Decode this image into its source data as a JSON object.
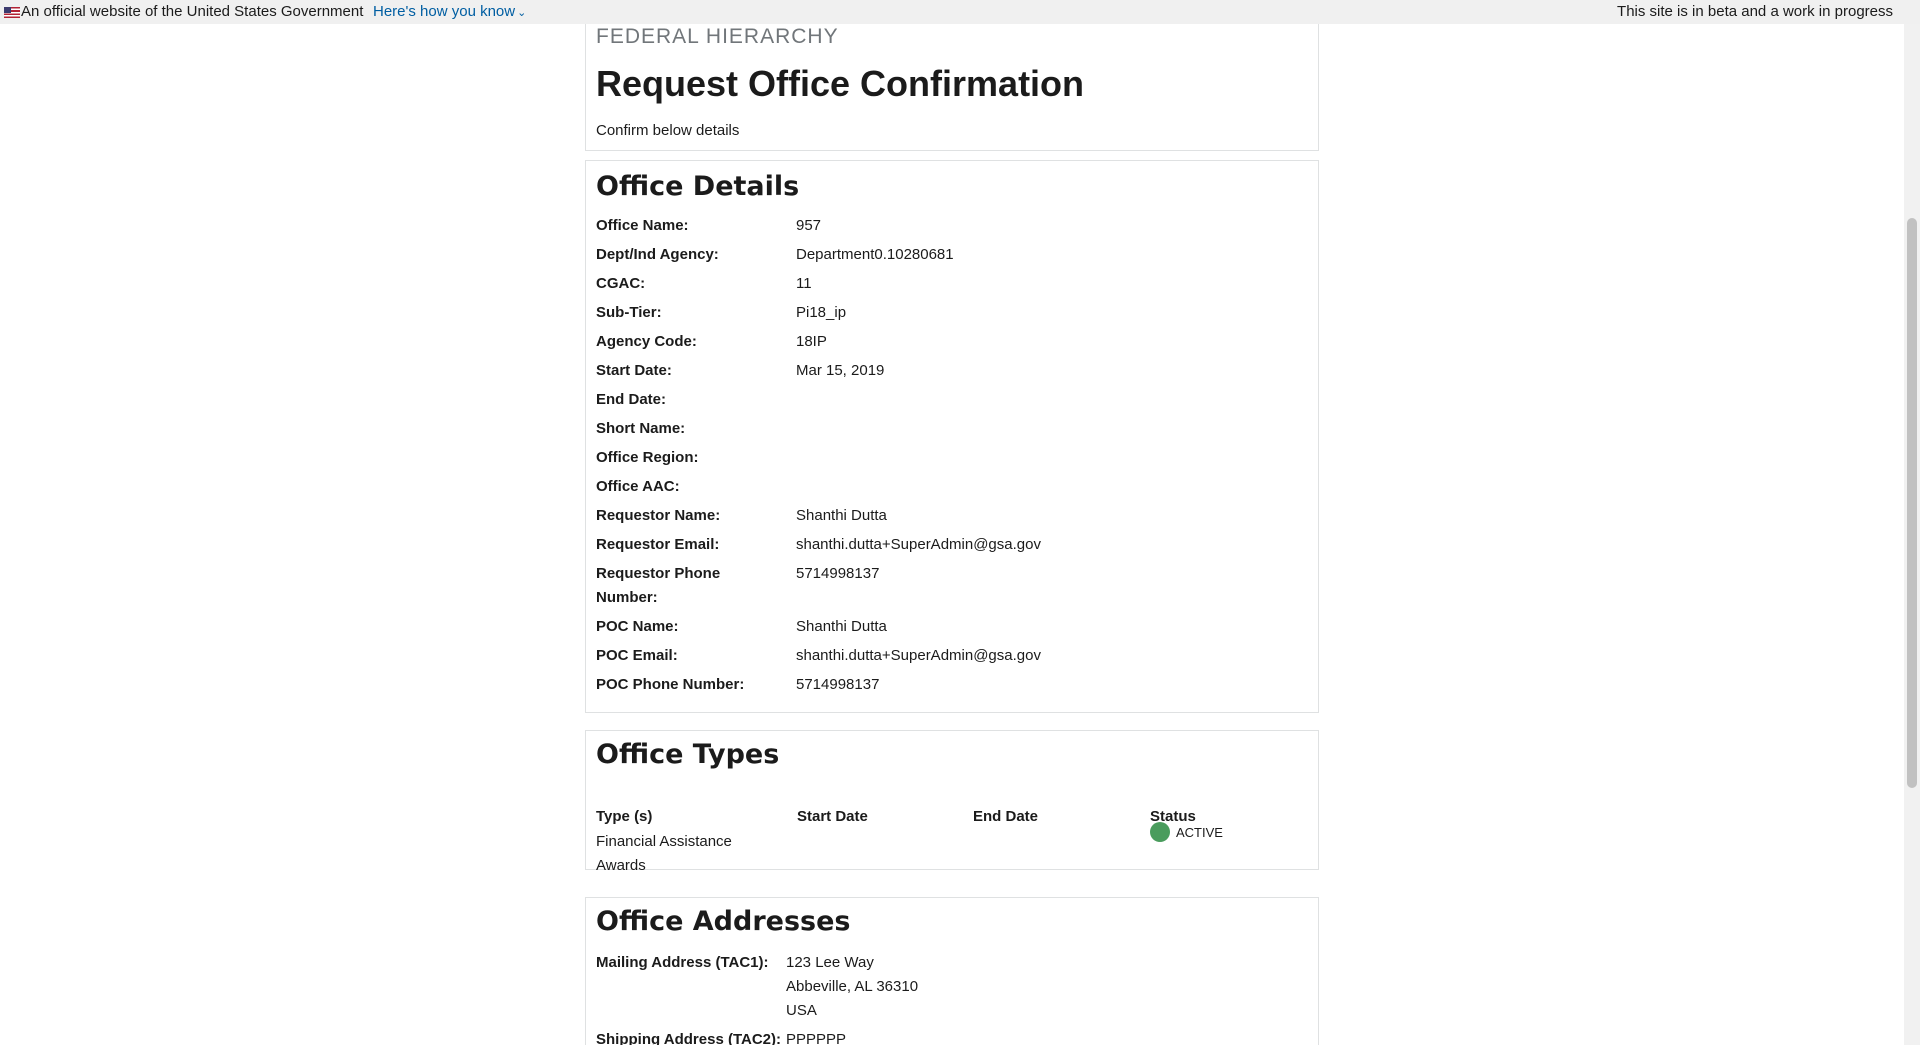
{
  "banner": {
    "official_text": "An official website of the United States Government",
    "how_link": "Here's how you know",
    "beta_text": "This site is in beta and a work in progress"
  },
  "header": {
    "eyebrow": "FEDERAL HIERARCHY",
    "title": "Request Office Confirmation",
    "subtitle": "Confirm below details"
  },
  "details": {
    "title": "Office Details",
    "fields": [
      {
        "label": "Office Name:",
        "value": "957"
      },
      {
        "label": "Dept/Ind Agency:",
        "value": "Department0.10280681"
      },
      {
        "label": "CGAC:",
        "value": "11"
      },
      {
        "label": "Sub-Tier:",
        "value": "Pi18_ip"
      },
      {
        "label": "Agency Code:",
        "value": "18IP"
      },
      {
        "label": "Start Date:",
        "value": "Mar 15, 2019"
      },
      {
        "label": "End Date:",
        "value": ""
      },
      {
        "label": "Short Name:",
        "value": ""
      },
      {
        "label": "Office Region:",
        "value": ""
      },
      {
        "label": "Office AAC:",
        "value": ""
      },
      {
        "label": "Requestor Name:",
        "value": "Shanthi Dutta"
      },
      {
        "label": "Requestor Email:",
        "value": "shanthi.dutta+SuperAdmin@gsa.gov"
      },
      {
        "label": "Requestor Phone Number:",
        "value": "5714998137"
      },
      {
        "label": "POC Name:",
        "value": "Shanthi Dutta"
      },
      {
        "label": "POC Email:",
        "value": "shanthi.dutta+SuperAdmin@gsa.gov"
      },
      {
        "label": "POC Phone Number:",
        "value": "5714998137"
      }
    ]
  },
  "types": {
    "title": "Office Types",
    "headers": [
      "Type (s)",
      "Start Date",
      "End Date",
      "Status"
    ],
    "rows": [
      {
        "type": "Financial Assistance Awards",
        "start": "",
        "end": "",
        "status": "ACTIVE",
        "status_color": "#4a9c5d"
      }
    ]
  },
  "addresses": {
    "title": "Office Addresses",
    "mailing_label": "Mailing Address (TAC1):",
    "mailing_line1": "123 Lee Way",
    "mailing_line2": "Abbeville, AL 36310",
    "mailing_line3": "USA",
    "shipping_label": "Shipping Address (TAC2):",
    "shipping_line1": "PPPPPP"
  },
  "colors": {
    "link": "#005ea2",
    "status_active": "#4a9c5d",
    "banner_bg": "#f0f0f0"
  }
}
